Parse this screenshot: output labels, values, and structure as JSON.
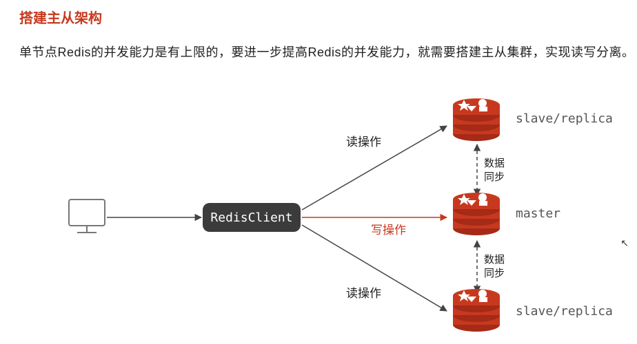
{
  "title": "搭建主从架构",
  "description": "单节点Redis的并发能力是有上限的，要进一步提高Redis的并发能力，就需要搭建主从集群，实现读写分离。",
  "diagram": {
    "client_label": "RedisClient",
    "edges": {
      "read_top": "读操作",
      "write": "写操作",
      "read_bottom": "读操作",
      "sync_top": "数据\n同步",
      "sync_bottom": "数据\n同步"
    },
    "nodes": {
      "slave_top": "slave/replica",
      "master": "master",
      "slave_bottom": "slave/replica"
    }
  }
}
